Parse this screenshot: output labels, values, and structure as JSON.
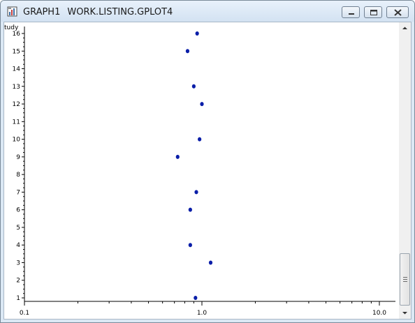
{
  "window": {
    "title_main": "GRAPH1",
    "title_sub": "WORK.LISTING.GPLOT4",
    "controls": {
      "minimize": "minimize-icon",
      "maximize": "maximize-icon",
      "close": "close-icon"
    }
  },
  "chart_data": {
    "type": "scatter",
    "ylabel": "tudy",
    "xscale": "log",
    "xlim": [
      0.1,
      10.0
    ],
    "ylim": [
      1,
      16
    ],
    "x_ticks": [
      "0.1",
      "1.0",
      "10.0"
    ],
    "y_ticks": [
      "1",
      "2",
      "3",
      "4",
      "5",
      "6",
      "7",
      "8",
      "9",
      "10",
      "11",
      "12",
      "13",
      "14",
      "15",
      "16"
    ],
    "points": [
      {
        "x": 0.94,
        "y": 16
      },
      {
        "x": 0.83,
        "y": 15
      },
      {
        "x": 0.9,
        "y": 13
      },
      {
        "x": 1.0,
        "y": 12
      },
      {
        "x": 0.97,
        "y": 10
      },
      {
        "x": 0.73,
        "y": 9
      },
      {
        "x": 0.93,
        "y": 7
      },
      {
        "x": 0.86,
        "y": 6
      },
      {
        "x": 0.86,
        "y": 4
      },
      {
        "x": 1.12,
        "y": 3
      },
      {
        "x": 0.92,
        "y": 1
      }
    ],
    "marker_color": "#0a1ea8",
    "axis_color": "#000000"
  }
}
